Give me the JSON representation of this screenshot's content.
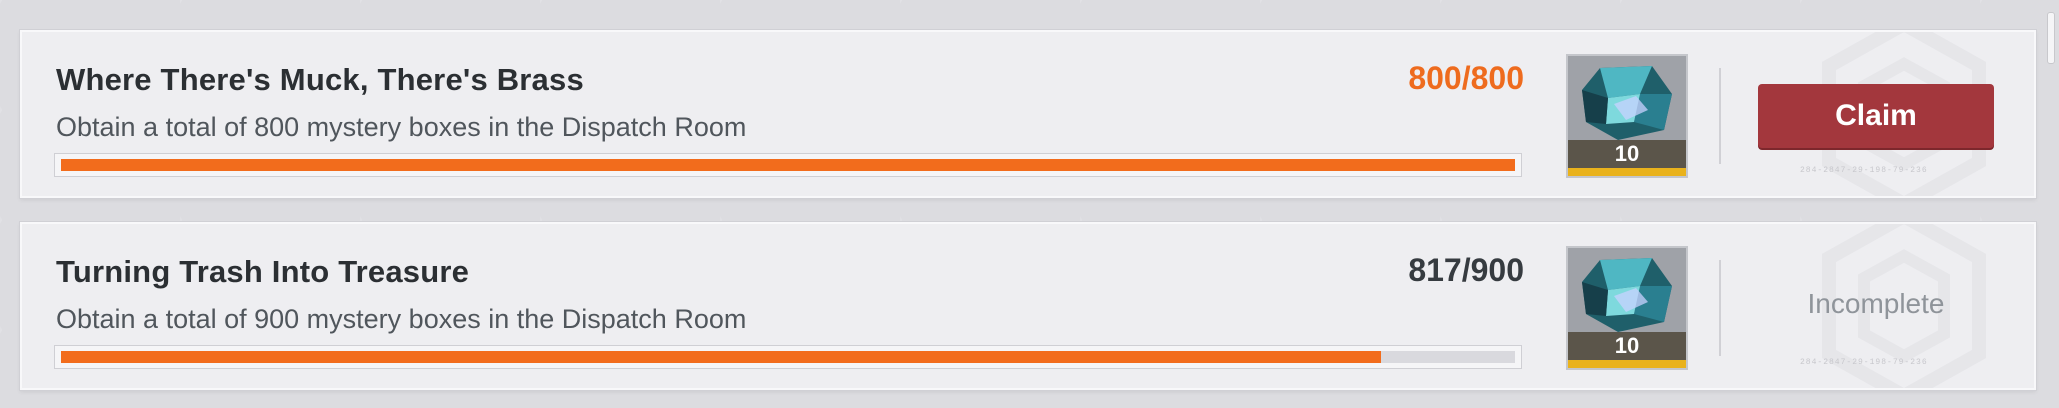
{
  "achievements": [
    {
      "title": "Where There's Muck, There's Brass",
      "description": "Obtain a total of 800 mystery boxes in the Dispatch Room",
      "progress_text": "800/800",
      "progress_fraction": 1.0,
      "reward": {
        "icon": "crystal-gem-icon",
        "quantity": "10"
      },
      "action_label": "Claim",
      "code": "284-2847-29-198-79-236"
    },
    {
      "title": "Turning Trash Into Treasure",
      "description": "Obtain a total of 900 mystery boxes in the Dispatch Room",
      "progress_text": "817/900",
      "progress_fraction": 0.9078,
      "reward": {
        "icon": "crystal-gem-icon",
        "quantity": "10"
      },
      "status_label": "Incomplete",
      "code": "284-2847-29-198-79-236"
    }
  ],
  "colors": {
    "progress_fill": "#f26c1c",
    "complete_count": "#ee6b1e",
    "claim_button": "#a3373d",
    "rarity_gold": "#e9b21c"
  }
}
